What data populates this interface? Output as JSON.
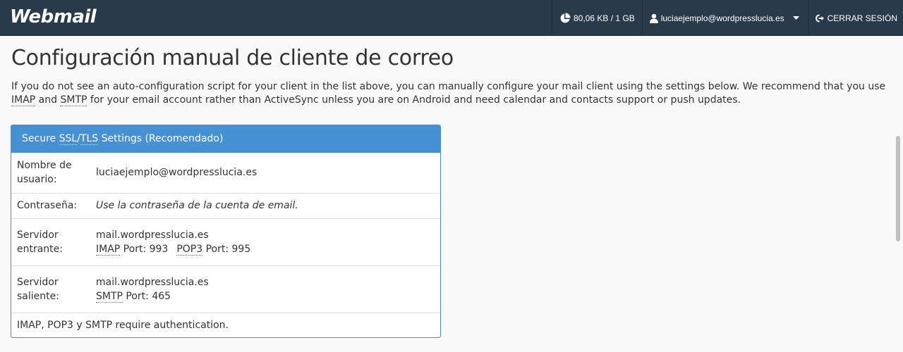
{
  "header": {
    "logo": "Webmail",
    "disk_usage": "80,06 KB / 1 GB",
    "user": "luciaejemplo@wordpresslucia.es",
    "logout": "CERRAR SESIÓN",
    "icons": [
      "pie-chart-icon",
      "user-icon",
      "caret-down-icon",
      "logout-icon"
    ]
  },
  "page": {
    "title": "Configuración manual de cliente de correo",
    "intro_1": "If you do not see an auto-configuration script for your client in the list above, you can manually configure your mail client using the settings below. We recommend that you use ",
    "intro_imap": "IMAP",
    "intro_and": " and ",
    "intro_smtp": "SMTP",
    "intro_2": " for your email account rather than ActiveSync unless you are on Android and need calendar and contacts support or push updates."
  },
  "panel": {
    "head_1": "Secure ",
    "head_ssl": "SSL",
    "head_slash": "/",
    "head_tls": "TLS",
    "head_2": " Settings (Recomendado)",
    "rows": {
      "username_label": "Nombre de usuario:",
      "username_value": "luciaejemplo@wordpresslucia.es",
      "password_label": "Contraseña:",
      "password_value": "Use la contraseña de la cuenta de email.",
      "incoming_label": "Servidor entrante:",
      "incoming_host": "mail.wordpresslucia.es",
      "imap_abbr": "IMAP",
      "imap_port": " Port: 993",
      "pop3_abbr": "POP3",
      "pop3_port": " Port: 995",
      "outgoing_label": "Servidor saliente:",
      "outgoing_host": "mail.wordpresslucia.es",
      "smtp_abbr": "SMTP",
      "smtp_port": " Port: 465",
      "auth_note": "IMAP, POP3 y SMTP require authentication."
    }
  },
  "colors": {
    "topbar": "#293a4a",
    "panel_header": "#4591d4",
    "panel_border": "#3d8fd1"
  }
}
